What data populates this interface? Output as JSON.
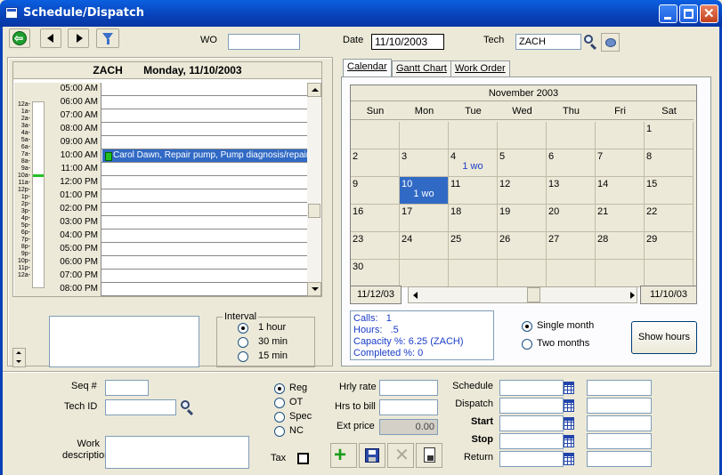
{
  "window": {
    "title": "Schedule/Dispatch"
  },
  "toolbar": {
    "wo_label": "WO",
    "wo_value": "",
    "date_label": "Date",
    "date_value": "11/10/2003",
    "tech_label": "Tech",
    "tech_value": "ZACH"
  },
  "day_view": {
    "header_tech": "ZACH",
    "header_date": "Monday, 11/10/2003",
    "gutter_labels": [
      "12a-",
      "1a-",
      "2a-",
      "3a-",
      "4a-",
      "5a-",
      "6a-",
      "7a-",
      "8a-",
      "9a-",
      "10a-",
      "11a-",
      "12p-",
      "1p-",
      "2p-",
      "3p-",
      "4p-",
      "5p-",
      "6p-",
      "7p-",
      "8p-",
      "9p-",
      "10p-",
      "11p-",
      "12a-"
    ],
    "rows": [
      {
        "time": "05:00 AM",
        "appt": ""
      },
      {
        "time": "06:00 AM",
        "appt": ""
      },
      {
        "time": "07:00 AM",
        "appt": ""
      },
      {
        "time": "08:00 AM",
        "appt": ""
      },
      {
        "time": "09:00 AM",
        "appt": ""
      },
      {
        "time": "10:00 AM",
        "appt": "Carol Dawn, Repair pump, Pump diagnosis/repair Cu"
      },
      {
        "time": "11:00 AM",
        "appt": ""
      },
      {
        "time": "12:00 PM",
        "appt": ""
      },
      {
        "time": "01:00 PM",
        "appt": ""
      },
      {
        "time": "02:00 PM",
        "appt": ""
      },
      {
        "time": "03:00 PM",
        "appt": ""
      },
      {
        "time": "04:00 PM",
        "appt": ""
      },
      {
        "time": "05:00 PM",
        "appt": ""
      },
      {
        "time": "06:00 PM",
        "appt": ""
      },
      {
        "time": "07:00 PM",
        "appt": ""
      },
      {
        "time": "08:00 PM",
        "appt": ""
      }
    ]
  },
  "interval": {
    "label": "Interval",
    "options": [
      "1 hour",
      "30 min",
      "15 min"
    ],
    "selected": "1 hour"
  },
  "tabs": [
    "Calendar",
    "Gantt Chart",
    "Work Order"
  ],
  "calendar": {
    "month_title": "November  2003",
    "dows": [
      "Sun",
      "Mon",
      "Tue",
      "Wed",
      "Thu",
      "Fri",
      "Sat"
    ],
    "weeks": [
      [
        {
          "d": ""
        },
        {
          "d": ""
        },
        {
          "d": ""
        },
        {
          "d": ""
        },
        {
          "d": ""
        },
        {
          "d": ""
        },
        {
          "d": "1"
        }
      ],
      [
        {
          "d": "2"
        },
        {
          "d": "3"
        },
        {
          "d": "4",
          "wo": "1 wo"
        },
        {
          "d": "5"
        },
        {
          "d": "6"
        },
        {
          "d": "7"
        },
        {
          "d": "8"
        }
      ],
      [
        {
          "d": "9"
        },
        {
          "d": "10",
          "wo": "1 wo",
          "sel": true
        },
        {
          "d": "11"
        },
        {
          "d": "12"
        },
        {
          "d": "13"
        },
        {
          "d": "14"
        },
        {
          "d": "15"
        }
      ],
      [
        {
          "d": "16"
        },
        {
          "d": "17"
        },
        {
          "d": "18"
        },
        {
          "d": "19"
        },
        {
          "d": "20"
        },
        {
          "d": "21"
        },
        {
          "d": "22"
        }
      ],
      [
        {
          "d": "23"
        },
        {
          "d": "24"
        },
        {
          "d": "25"
        },
        {
          "d": "26"
        },
        {
          "d": "27"
        },
        {
          "d": "28"
        },
        {
          "d": "29"
        }
      ],
      [
        {
          "d": "30"
        },
        {
          "d": ""
        },
        {
          "d": ""
        },
        {
          "d": ""
        },
        {
          "d": ""
        },
        {
          "d": ""
        },
        {
          "d": ""
        }
      ]
    ],
    "nav_left": "11/12/03",
    "nav_right": "11/10/03"
  },
  "stats": {
    "calls_label": "Calls:",
    "calls": "1",
    "hours_label": "Hours:",
    "hours": ".5",
    "capacity_label": "Capacity %:",
    "capacity": "6.25 (ZACH)",
    "completed_label": "Completed %:",
    "completed": "0"
  },
  "month_mode": {
    "options": [
      "Single month",
      "Two months"
    ],
    "selected": "Single month"
  },
  "show_hours_button": "Show hours",
  "form": {
    "seq_label": "Seq #",
    "seq_value": "",
    "techid_label": "Tech ID",
    "techid_value": "",
    "workdesc_label": "Work description",
    "workdesc_value": "",
    "rate_types": [
      "Reg",
      "OT",
      "Spec",
      "NC"
    ],
    "rate_selected": "Reg",
    "tax_label": "Tax",
    "hrly_rate_label": "Hrly rate",
    "hrly_rate_value": "",
    "hrs_to_bill_label": "Hrs to bill",
    "hrs_to_bill_value": "",
    "ext_price_label": "Ext price",
    "ext_price_value": "0.00",
    "schedule_label": "Schedule",
    "dispatch_label": "Dispatch",
    "start_label": "Start",
    "stop_label": "Stop",
    "return_label": "Return"
  }
}
